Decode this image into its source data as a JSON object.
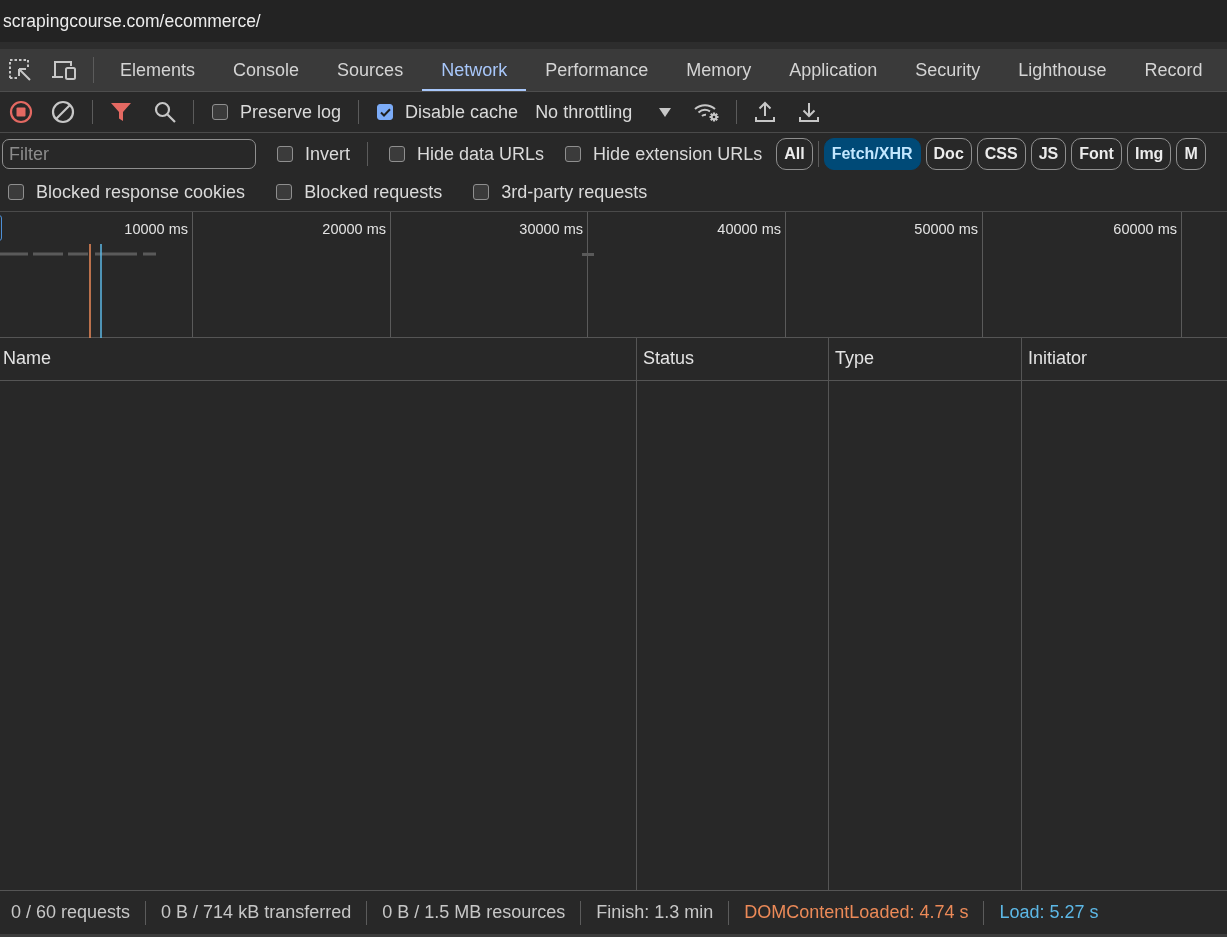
{
  "address_bar": {
    "url": "scrapingcourse.com/ecommerce/"
  },
  "tabs": [
    {
      "label": "Elements",
      "selected": false
    },
    {
      "label": "Console",
      "selected": false
    },
    {
      "label": "Sources",
      "selected": false
    },
    {
      "label": "Network",
      "selected": true
    },
    {
      "label": "Performance",
      "selected": false
    },
    {
      "label": "Memory",
      "selected": false
    },
    {
      "label": "Application",
      "selected": false
    },
    {
      "label": "Security",
      "selected": false
    },
    {
      "label": "Lighthouse",
      "selected": false
    },
    {
      "label": "Record",
      "selected": false
    }
  ],
  "toolbar": {
    "recording": true,
    "filter_active": true,
    "checkboxes": [
      {
        "label": "Preserve log",
        "checked": false
      },
      {
        "label": "Disable cache",
        "checked": true
      }
    ],
    "throttling": "No throttling"
  },
  "filters": {
    "placeholder": "Filter",
    "options": [
      {
        "label": "Invert",
        "checked": false
      },
      {
        "label": "Hide data URLs",
        "checked": false
      },
      {
        "label": "Hide extension URLs",
        "checked": false
      }
    ],
    "types": [
      {
        "label": "All",
        "selected": false
      },
      {
        "label": "Fetch/XHR",
        "selected": true
      },
      {
        "label": "Doc",
        "selected": false
      },
      {
        "label": "CSS",
        "selected": false
      },
      {
        "label": "JS",
        "selected": false
      },
      {
        "label": "Font",
        "selected": false
      },
      {
        "label": "Img",
        "selected": false
      },
      {
        "label": "M",
        "selected": false
      }
    ],
    "more_options": [
      {
        "label": "Blocked response cookies",
        "checked": false
      },
      {
        "label": "Blocked requests",
        "checked": false
      },
      {
        "label": "3rd-party requests",
        "checked": false
      }
    ]
  },
  "overview": {
    "ticks": [
      "10000 ms",
      "20000 ms",
      "30000 ms",
      "40000 ms",
      "50000 ms",
      "60000 ms"
    ]
  },
  "table": {
    "columns": [
      "Name",
      "Status",
      "Type",
      "Initiator"
    ]
  },
  "status_bar": {
    "items": [
      {
        "text": "0 / 60 requests",
        "color": "#c7c7c7"
      },
      {
        "text": "0 B / 714 kB transferred",
        "color": "#c7c7c7"
      },
      {
        "text": "0 B / 1.5 MB resources",
        "color": "#c7c7c7"
      },
      {
        "text": "Finish: 1.3 min",
        "color": "#c7c7c7"
      },
      {
        "text": "DOMContentLoaded: 4.74 s",
        "color": "#ec8a58"
      },
      {
        "text": "Load: 5.27 s",
        "color": "#5db8e6"
      }
    ]
  }
}
